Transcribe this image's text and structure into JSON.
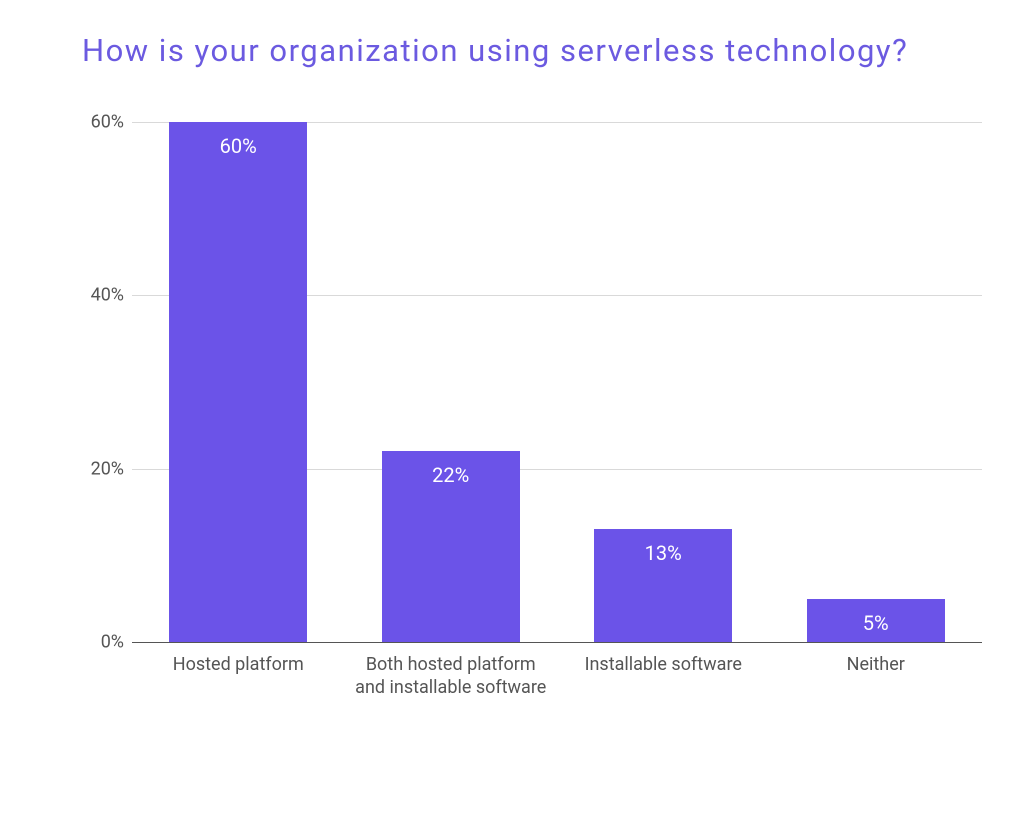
{
  "chart_data": {
    "type": "bar",
    "title": "How is your organization using serverless technology?",
    "categories": [
      "Hosted platform",
      "Both hosted platform and installable software",
      "Installable software",
      "Neither"
    ],
    "values": [
      60,
      22,
      13,
      5
    ],
    "value_labels": [
      "60%",
      "22%",
      "13%",
      "5%"
    ],
    "xlabel": "",
    "ylabel": "",
    "ylim": [
      0,
      60
    ],
    "y_ticks": [
      0,
      20,
      40,
      60
    ],
    "y_tick_labels": [
      "0%",
      "20%",
      "40%",
      "60%"
    ]
  }
}
